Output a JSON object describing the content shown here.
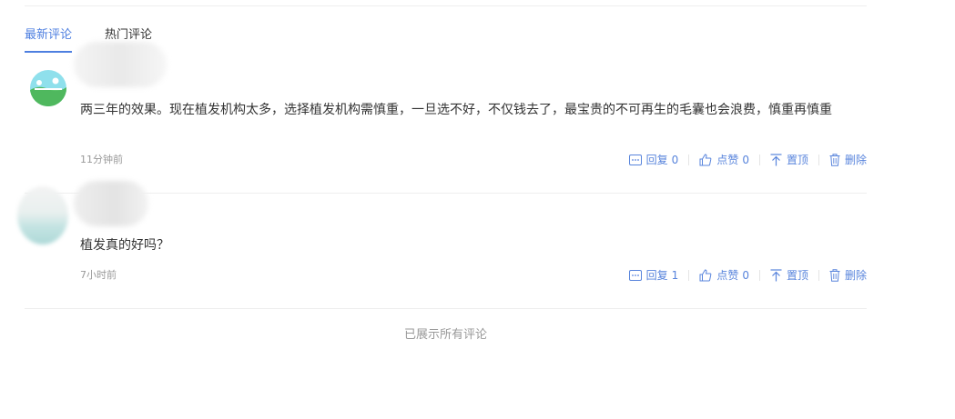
{
  "tabs": [
    {
      "label": "最新评论",
      "active": true
    },
    {
      "label": "热门评论",
      "active": false
    }
  ],
  "comments": [
    {
      "text": "两三年的效果。现在植发机构太多，选择植发机构需慎重，一旦选不好，不仅钱去了，最宝贵的不可再生的毛囊也会浪费，慎重再慎重",
      "time": "11分钟前",
      "reply_label": "回复",
      "reply_count": "0",
      "like_label": "点赞",
      "like_count": "0",
      "top_label": "置顶",
      "delete_label": "删除"
    },
    {
      "text": "植发真的好吗？",
      "time": "7小时前",
      "reply_label": "回复",
      "reply_count": "1",
      "like_label": "点赞",
      "like_count": "0",
      "top_label": "置顶",
      "delete_label": "删除"
    }
  ],
  "footer": {
    "all_shown": "已展示所有评论"
  },
  "colors": {
    "accent": "#4e7fe0",
    "action": "#5884dc",
    "muted": "#999999",
    "divider": "#eeeeee"
  },
  "icons": [
    "comment-icon",
    "thumbs-up-icon",
    "pin-top-icon",
    "trash-icon"
  ]
}
